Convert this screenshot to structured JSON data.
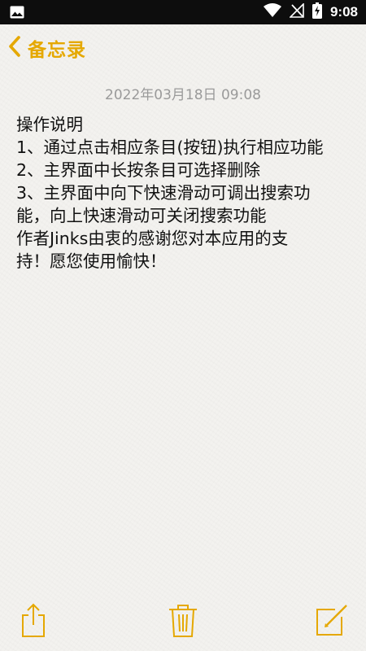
{
  "status_bar": {
    "time": "9:08",
    "icons": [
      "image-icon",
      "wifi-icon",
      "signal-icon",
      "battery-charging-icon"
    ]
  },
  "header": {
    "back_label": "备忘录",
    "back_icon": "chevron-left-icon"
  },
  "note": {
    "date": "2022年03月18日 09:08",
    "lines": [
      "操作说明",
      "1、通过点击相应条目(按钮)执行相应功能",
      "2、主界面中长按条目可选择删除",
      "3、主界面中向下快速滑动可调出搜索功",
      "能，向上快速滑动可关闭搜索功能",
      "作者Jinks由衷的感谢您对本应用的支",
      "持！愿您使用愉快！"
    ]
  },
  "toolbar": {
    "items": [
      "share-icon",
      "trash-icon",
      "compose-icon"
    ]
  },
  "colors": {
    "accent": "#e5a800",
    "background": "#f3f2ef",
    "date_text": "#9a9a9a",
    "status_bar": "#0d0d0d"
  }
}
